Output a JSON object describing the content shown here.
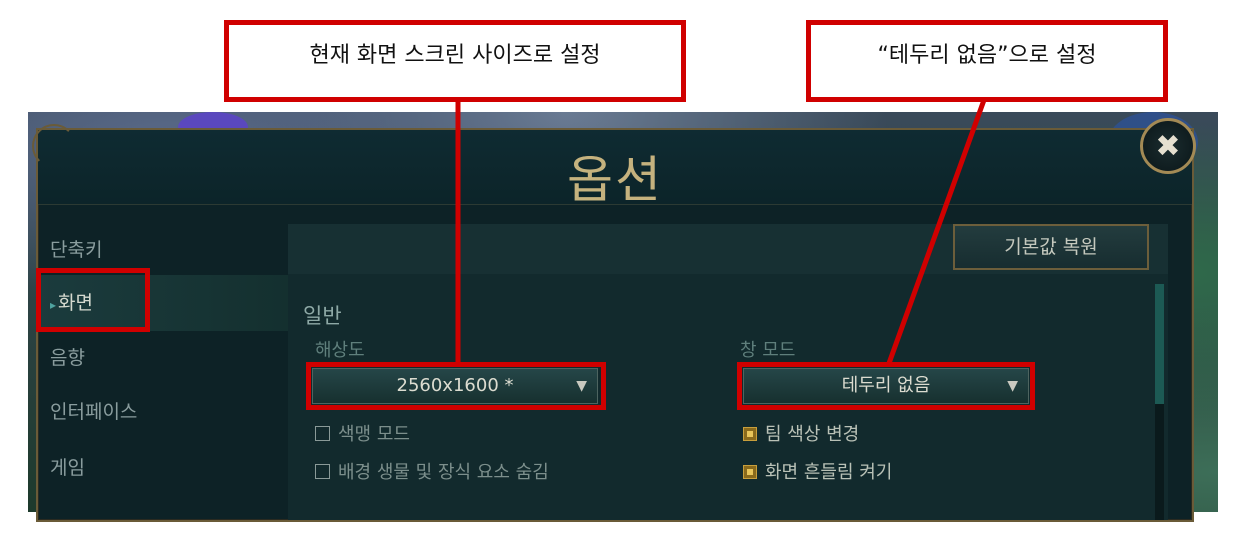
{
  "window": {
    "title": "옵션",
    "close_icon": "close-icon"
  },
  "sidebar": {
    "items": [
      {
        "label": "단축키",
        "active": false
      },
      {
        "label": "화면",
        "active": true
      },
      {
        "label": "음향",
        "active": false
      },
      {
        "label": "인터페이스",
        "active": false
      },
      {
        "label": "게임",
        "active": false
      }
    ]
  },
  "toolbar": {
    "reset_label": "기본값 복원"
  },
  "general": {
    "section_title": "일반",
    "resolution": {
      "label": "해상도",
      "value": "2560x1600 *"
    },
    "window_mode": {
      "label": "창 모드",
      "value": "테두리 없음"
    },
    "checkboxes": [
      {
        "label": "색맹 모드",
        "checked": false
      },
      {
        "label": "배경 생물 및 장식 요소 숨김",
        "checked": false
      },
      {
        "label": "팀 색상 변경",
        "checked": true
      },
      {
        "label": "화면 흔들림 켜기",
        "checked": true
      }
    ]
  },
  "annotations": {
    "resolution_note": "현재 화면 스크린 사이즈로 설정",
    "window_mode_note": "“테두리 없음”으로 설정"
  },
  "colors": {
    "accent_gold": "#c5b27e",
    "highlight_red": "#d00000"
  }
}
